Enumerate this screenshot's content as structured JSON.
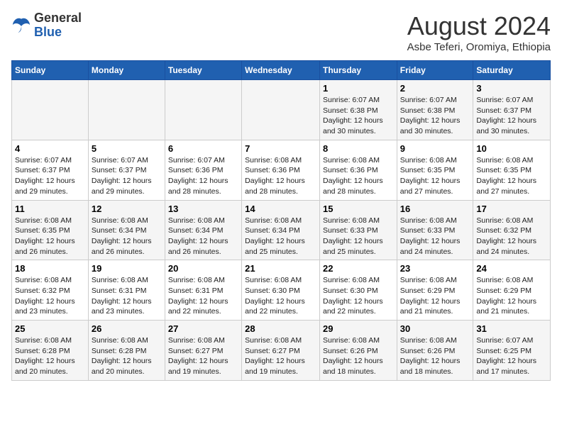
{
  "logo": {
    "general": "General",
    "blue": "Blue"
  },
  "title": "August 2024",
  "location": "Asbe Teferi, Oromiya, Ethiopia",
  "days_of_week": [
    "Sunday",
    "Monday",
    "Tuesday",
    "Wednesday",
    "Thursday",
    "Friday",
    "Saturday"
  ],
  "weeks": [
    [
      {
        "day": "",
        "info": ""
      },
      {
        "day": "",
        "info": ""
      },
      {
        "day": "",
        "info": ""
      },
      {
        "day": "",
        "info": ""
      },
      {
        "day": "1",
        "sunrise": "6:07 AM",
        "sunset": "6:38 PM",
        "daylight": "12 hours and 30 minutes."
      },
      {
        "day": "2",
        "sunrise": "6:07 AM",
        "sunset": "6:38 PM",
        "daylight": "12 hours and 30 minutes."
      },
      {
        "day": "3",
        "sunrise": "6:07 AM",
        "sunset": "6:37 PM",
        "daylight": "12 hours and 30 minutes."
      }
    ],
    [
      {
        "day": "4",
        "sunrise": "6:07 AM",
        "sunset": "6:37 PM",
        "daylight": "12 hours and 29 minutes."
      },
      {
        "day": "5",
        "sunrise": "6:07 AM",
        "sunset": "6:37 PM",
        "daylight": "12 hours and 29 minutes."
      },
      {
        "day": "6",
        "sunrise": "6:07 AM",
        "sunset": "6:36 PM",
        "daylight": "12 hours and 28 minutes."
      },
      {
        "day": "7",
        "sunrise": "6:08 AM",
        "sunset": "6:36 PM",
        "daylight": "12 hours and 28 minutes."
      },
      {
        "day": "8",
        "sunrise": "6:08 AM",
        "sunset": "6:36 PM",
        "daylight": "12 hours and 28 minutes."
      },
      {
        "day": "9",
        "sunrise": "6:08 AM",
        "sunset": "6:35 PM",
        "daylight": "12 hours and 27 minutes."
      },
      {
        "day": "10",
        "sunrise": "6:08 AM",
        "sunset": "6:35 PM",
        "daylight": "12 hours and 27 minutes."
      }
    ],
    [
      {
        "day": "11",
        "sunrise": "6:08 AM",
        "sunset": "6:35 PM",
        "daylight": "12 hours and 26 minutes."
      },
      {
        "day": "12",
        "sunrise": "6:08 AM",
        "sunset": "6:34 PM",
        "daylight": "12 hours and 26 minutes."
      },
      {
        "day": "13",
        "sunrise": "6:08 AM",
        "sunset": "6:34 PM",
        "daylight": "12 hours and 26 minutes."
      },
      {
        "day": "14",
        "sunrise": "6:08 AM",
        "sunset": "6:34 PM",
        "daylight": "12 hours and 25 minutes."
      },
      {
        "day": "15",
        "sunrise": "6:08 AM",
        "sunset": "6:33 PM",
        "daylight": "12 hours and 25 minutes."
      },
      {
        "day": "16",
        "sunrise": "6:08 AM",
        "sunset": "6:33 PM",
        "daylight": "12 hours and 24 minutes."
      },
      {
        "day": "17",
        "sunrise": "6:08 AM",
        "sunset": "6:32 PM",
        "daylight": "12 hours and 24 minutes."
      }
    ],
    [
      {
        "day": "18",
        "sunrise": "6:08 AM",
        "sunset": "6:32 PM",
        "daylight": "12 hours and 23 minutes."
      },
      {
        "day": "19",
        "sunrise": "6:08 AM",
        "sunset": "6:31 PM",
        "daylight": "12 hours and 23 minutes."
      },
      {
        "day": "20",
        "sunrise": "6:08 AM",
        "sunset": "6:31 PM",
        "daylight": "12 hours and 22 minutes."
      },
      {
        "day": "21",
        "sunrise": "6:08 AM",
        "sunset": "6:30 PM",
        "daylight": "12 hours and 22 minutes."
      },
      {
        "day": "22",
        "sunrise": "6:08 AM",
        "sunset": "6:30 PM",
        "daylight": "12 hours and 22 minutes."
      },
      {
        "day": "23",
        "sunrise": "6:08 AM",
        "sunset": "6:29 PM",
        "daylight": "12 hours and 21 minutes."
      },
      {
        "day": "24",
        "sunrise": "6:08 AM",
        "sunset": "6:29 PM",
        "daylight": "12 hours and 21 minutes."
      }
    ],
    [
      {
        "day": "25",
        "sunrise": "6:08 AM",
        "sunset": "6:28 PM",
        "daylight": "12 hours and 20 minutes."
      },
      {
        "day": "26",
        "sunrise": "6:08 AM",
        "sunset": "6:28 PM",
        "daylight": "12 hours and 20 minutes."
      },
      {
        "day": "27",
        "sunrise": "6:08 AM",
        "sunset": "6:27 PM",
        "daylight": "12 hours and 19 minutes."
      },
      {
        "day": "28",
        "sunrise": "6:08 AM",
        "sunset": "6:27 PM",
        "daylight": "12 hours and 19 minutes."
      },
      {
        "day": "29",
        "sunrise": "6:08 AM",
        "sunset": "6:26 PM",
        "daylight": "12 hours and 18 minutes."
      },
      {
        "day": "30",
        "sunrise": "6:08 AM",
        "sunset": "6:26 PM",
        "daylight": "12 hours and 18 minutes."
      },
      {
        "day": "31",
        "sunrise": "6:07 AM",
        "sunset": "6:25 PM",
        "daylight": "12 hours and 17 minutes."
      }
    ]
  ]
}
